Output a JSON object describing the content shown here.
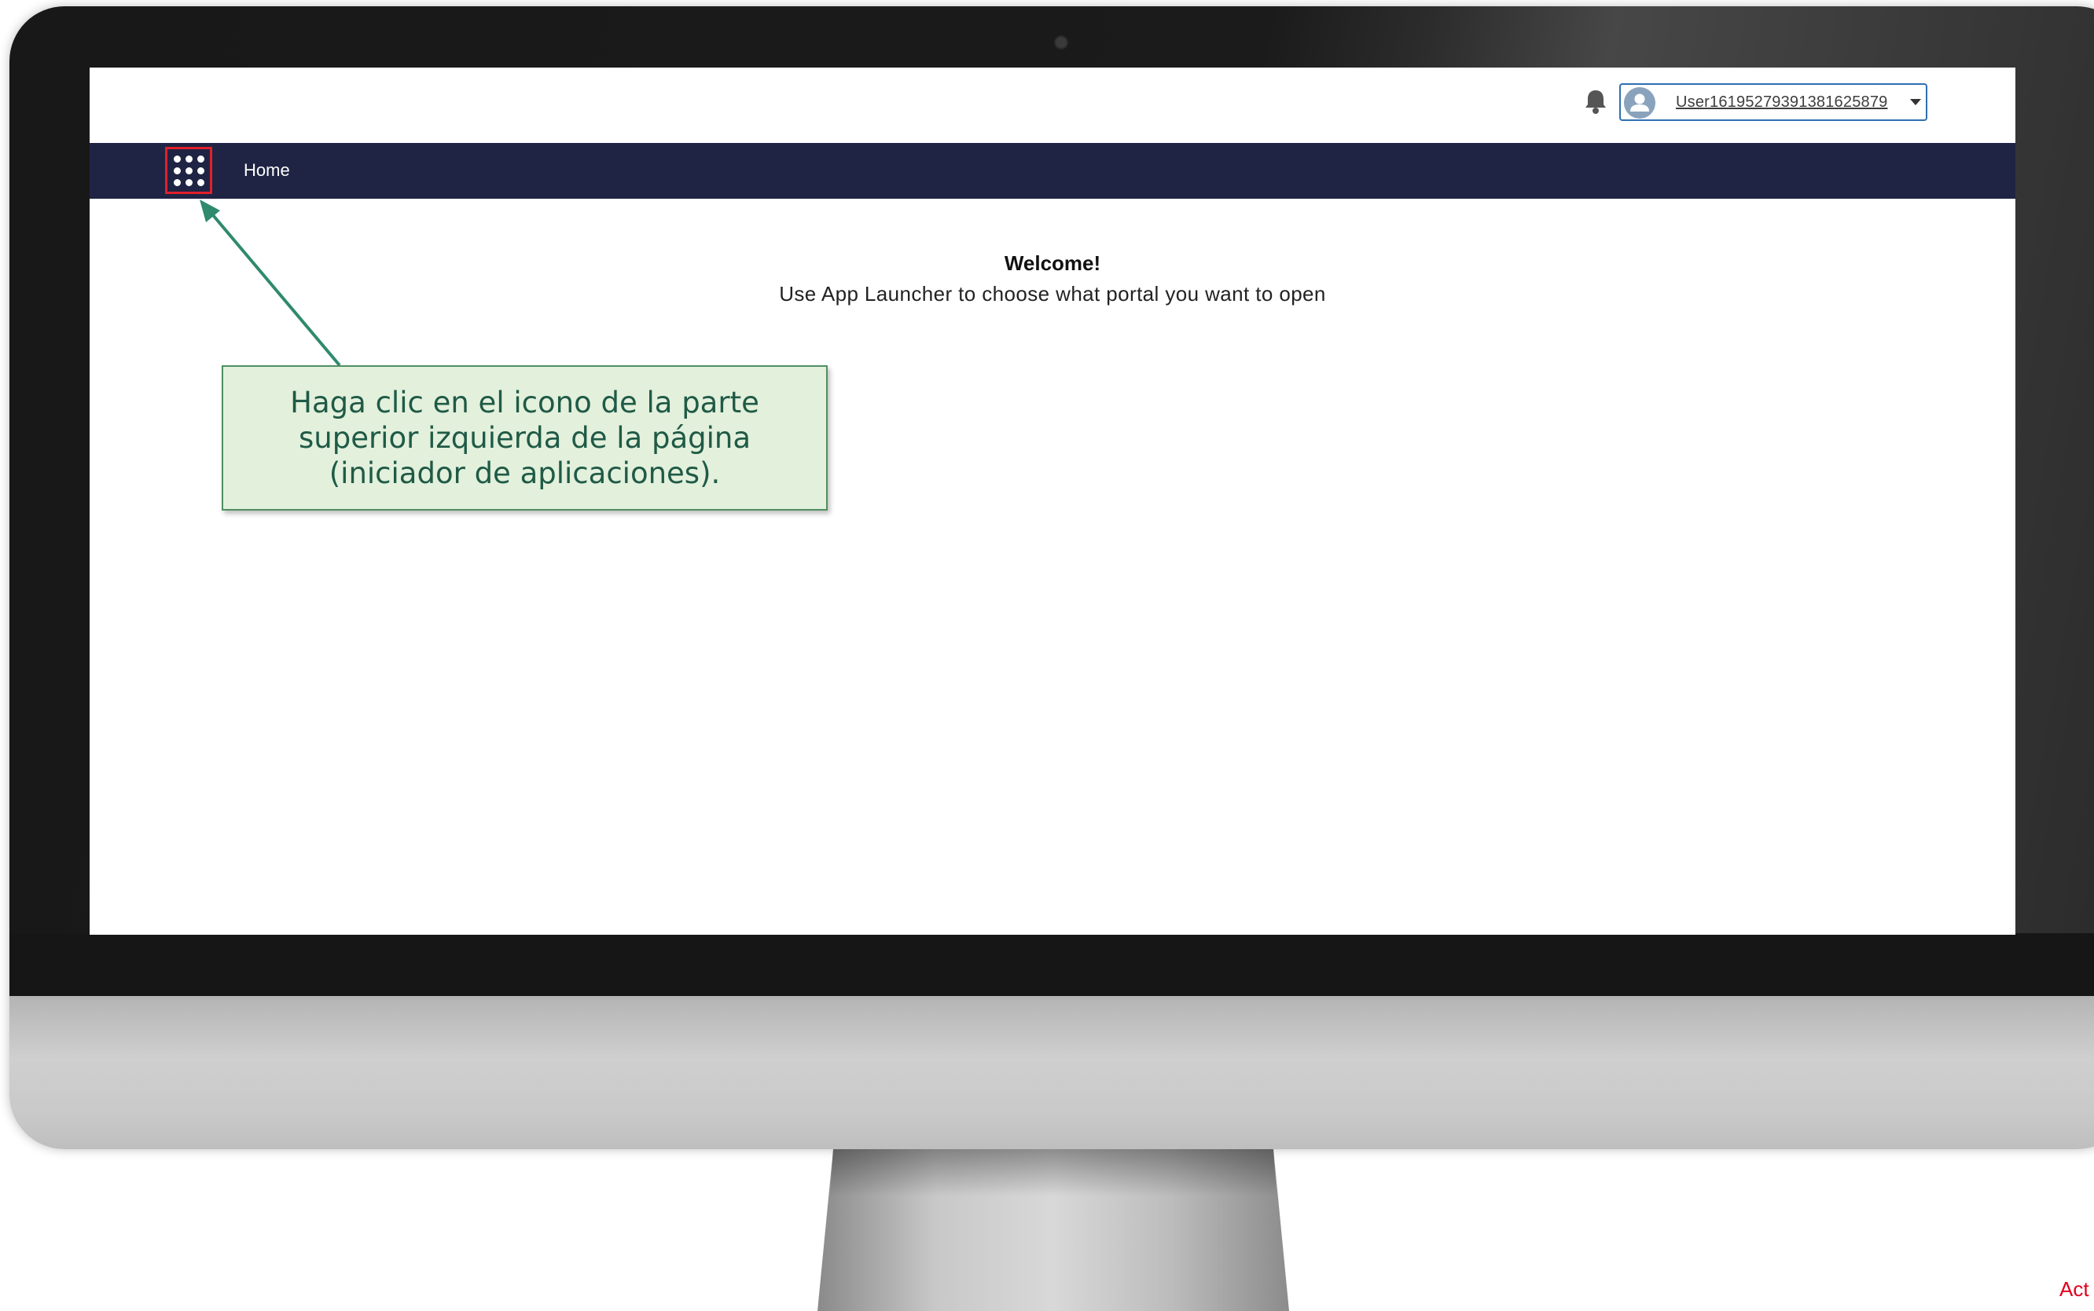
{
  "header": {
    "username": "User16195279391381625879",
    "icons": [
      "bell-icon",
      "user-avatar-icon",
      "chevron-down-icon"
    ]
  },
  "navbar": {
    "launcher_icon": "app-launcher-grid-icon",
    "home_label": "Home",
    "background_color": "#1f2444"
  },
  "main": {
    "welcome_title": "Welcome!",
    "welcome_subtitle": "Use App Launcher to choose what portal you want to open"
  },
  "annotation": {
    "callout_text": "Haga clic en el icono de la parte superior izquierda de la página (iniciador de aplicaciones).",
    "highlight_color": "#e0202a",
    "arrow_color": "#2f8a6e"
  },
  "corner_text": "Act"
}
